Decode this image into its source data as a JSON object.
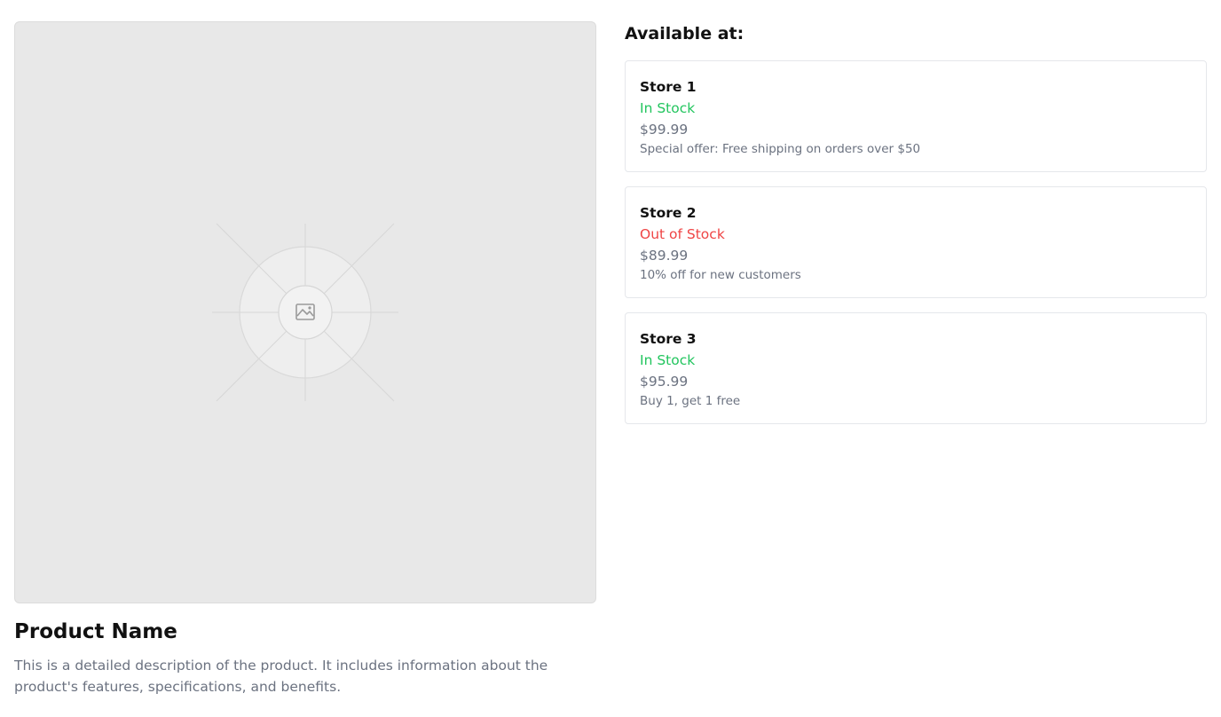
{
  "product": {
    "title": "Product Name",
    "description": "This is a detailed description of the product. It includes information about the product's features, specifications, and benefits.",
    "image_icon": "image-icon"
  },
  "availability": {
    "heading": "Available at:",
    "stores": [
      {
        "name": "Store 1",
        "status": "In Stock",
        "status_color": "#22c55e",
        "price": "$99.99",
        "offer": "Special offer: Free shipping on orders over $50"
      },
      {
        "name": "Store 2",
        "status": "Out of Stock",
        "status_color": "#ef4444",
        "price": "$89.99",
        "offer": "10% off for new customers"
      },
      {
        "name": "Store 3",
        "status": "In Stock",
        "status_color": "#22c55e",
        "price": "$95.99",
        "offer": "Buy 1, get 1 free"
      }
    ]
  },
  "colors": {
    "in_stock": "#22c55e",
    "out_of_stock": "#ef4444",
    "muted_text": "#6b7280",
    "placeholder_bg": "#e8e8e8"
  }
}
